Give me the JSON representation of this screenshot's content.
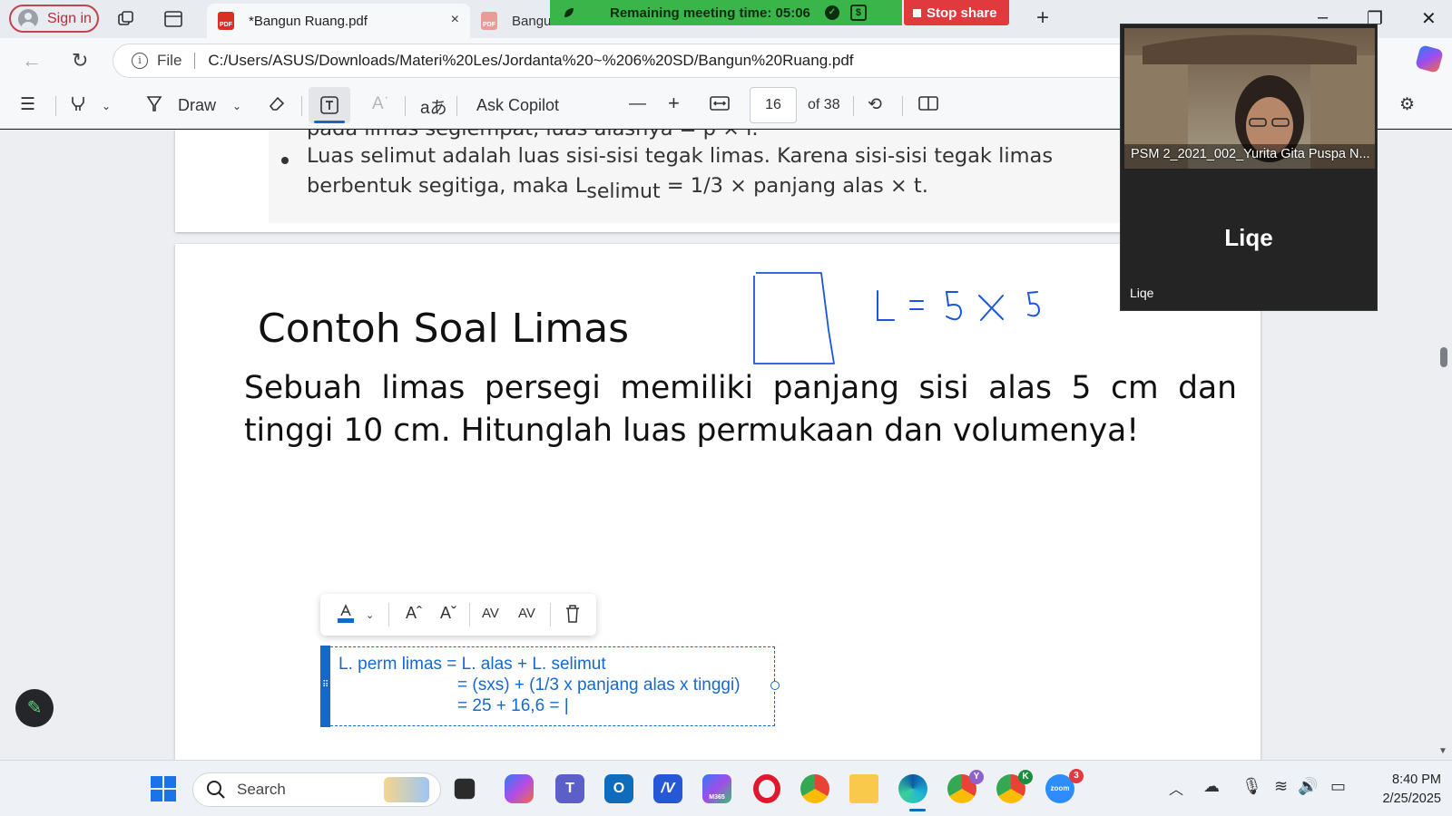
{
  "browser": {
    "sign_in_label": "Sign in",
    "active_tab_title": "*Bangun Ruang.pdf",
    "second_tab_title": "Bangun",
    "file_label": "File",
    "url": "C:/Users/ASUS/Downloads/Materi%20Les/Jordanta%20~%206%20SD/Bangun%20Ruang.pdf",
    "tab_close_glyph": "×",
    "new_tab_glyph": "+"
  },
  "meeting_bar": {
    "remaining_text": "Remaining meeting time: 05:06",
    "stop_share_label": "Stop share",
    "accent_green": "#3ab54a",
    "stop_red": "#e0393e"
  },
  "pdf_toolbar": {
    "draw_label": "Draw",
    "ask_copilot_label": "Ask Copilot",
    "page_number": "16",
    "page_total": "of 38"
  },
  "document": {
    "page1_lines": [
      "pada limas segiempat, luas alasnya = p × l.",
      "Luas selimut adalah luas sisi-sisi tegak limas. Karena sisi-sisi tegak limas",
      "berbentuk segitiga, maka L",
      "selimut",
      " = 1/3 × panjang alas × t."
    ],
    "title": "Contoh Soal Limas",
    "question_line1": "Sebuah limas persegi memiliki panjang sisi alas 5 cm dan",
    "question_line2": "tinggi 10 cm. Hitunglah luas permukaan dan volumenya!",
    "textbox_lines": [
      "L. perm limas = L. alas + L. selimut",
      "= (sxs) + (1/3 x panjang alas x tinggi)",
      "= 25 + 16,6 = |"
    ],
    "ink_color": "#1a56db",
    "text_color": "#1868d1"
  },
  "zoom_panel": {
    "participant1_name": "PSM 2_2021_002_Yurita Gita Puspa N...",
    "participant2_big": "Liqe",
    "participant2_small": "Liqe"
  },
  "taskbar": {
    "search_label": "Search",
    "time": "8:40 PM",
    "date": "2/25/2025",
    "zoom_badge": "3",
    "chrome_badge_1": "Y",
    "chrome_badge_2": "K",
    "m365_label": "M365",
    "zoom_label": "zoom"
  }
}
